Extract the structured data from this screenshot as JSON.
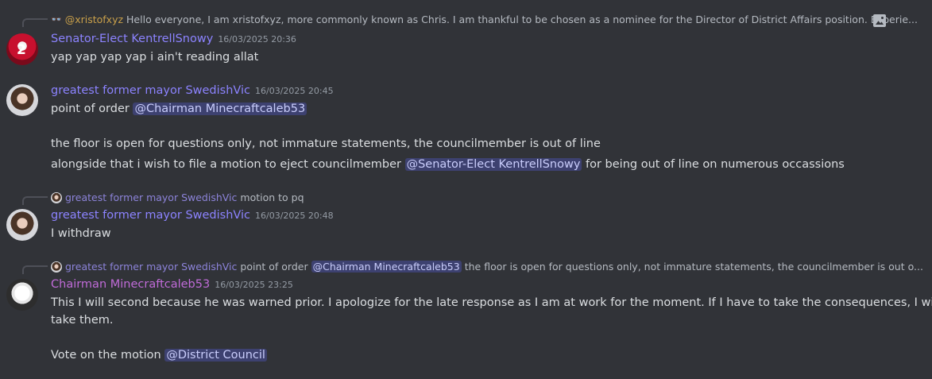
{
  "messages": [
    {
      "reply": {
        "icon": "glasses-icon",
        "name": "@xristofxyz",
        "text": "Hello everyone, I am xristofxyz, more commonly known as Chris. I am thankful to be chosen as a nominee for the Director of District Affairs position. Experie..."
      },
      "author": "Senator-Elect KentrellSnowy",
      "author_color": "#8c83ff",
      "timestamp": "16/03/2025 20:36",
      "lines": [
        "yap yap yap yap i ain't reading allat"
      ]
    },
    {
      "author": "greatest former mayor SwedishVic",
      "author_color": "#8c83ff",
      "timestamp": "16/03/2025 20:45",
      "line1_prefix": "point of order ",
      "line1_mention": "@Chairman Minecraftcaleb53",
      "line2": "the floor is open for questions only, not immature statements, the councilmember is out of line",
      "line3_prefix": "alongside that i wish to file a motion to eject councilmember ",
      "line3_mention": "@Senator-Elect KentrellSnowy",
      "line3_suffix": " for being out of line on numerous occassions"
    },
    {
      "reply": {
        "name": "greatest former mayor SwedishVic",
        "text": "motion to pq"
      },
      "author": "greatest former mayor SwedishVic",
      "author_color": "#8c83ff",
      "timestamp": "16/03/2025 20:48",
      "lines": [
        "I withdraw"
      ]
    },
    {
      "reply": {
        "name": "greatest former mayor SwedishVic",
        "text_prefix": "point of order",
        "mention": "@Chairman Minecraftcaleb53",
        "text_suffix": " the floor is open for questions only, not immature statements, the councilmember is out o..."
      },
      "author": "Chairman Minecraftcaleb53",
      "author_color": "#c06bd8",
      "timestamp": "16/03/2025 23:25",
      "line1": "This I will second because he was warned prior. I apologize for the late response as I am at work for the moment. If I have to take the consequences, I will",
      "line2": "take them.",
      "line3_prefix": "Vote on the motion ",
      "line3_mention": "@District Council"
    }
  ],
  "colors": {
    "background": "#313338",
    "text": "#dbdee1",
    "timestamp": "#949ba4",
    "mention_bg": "rgba(88,101,242,0.3)"
  }
}
